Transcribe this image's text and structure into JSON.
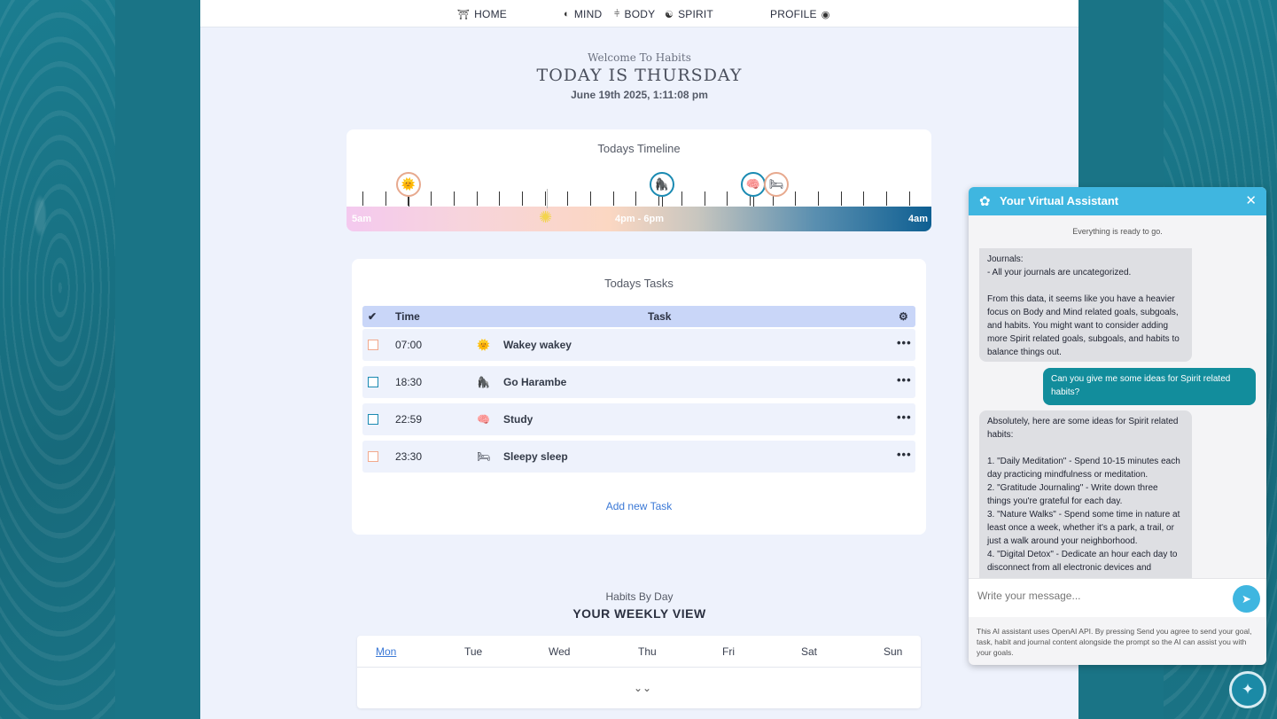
{
  "nav": {
    "home": "HOME",
    "mind": "MIND",
    "body": "BODY",
    "spirit": "SPIRIT",
    "profile": "PROFILE"
  },
  "welcome": {
    "subtitle": "Welcome To Habits",
    "title": "TODAY IS THURSDAY",
    "datetime": "June 19th 2025, 1:11:08 pm"
  },
  "timeline": {
    "title": "Todays Timeline",
    "start_label": "5am",
    "mid_label": "4pm - 6pm",
    "end_label": "4am"
  },
  "tasks": {
    "title": "Todays Tasks",
    "headers": {
      "time": "Time",
      "task": "Task"
    },
    "rows": [
      {
        "time": "07:00",
        "name": "Wakey wakey",
        "icon": "sun-icon",
        "done": false
      },
      {
        "time": "18:30",
        "name": "Go Harambe",
        "icon": "gorilla-icon",
        "done": false
      },
      {
        "time": "22:59",
        "name": "Study",
        "icon": "brain-icon",
        "done": false
      },
      {
        "time": "23:30",
        "name": "Sleepy sleep",
        "icon": "bed-icon",
        "done": false
      }
    ],
    "add_label": "Add new Task"
  },
  "habits": {
    "subtitle": "Habits By Day",
    "title": "YOUR WEEKLY VIEW",
    "days": [
      "Mon",
      "Tue",
      "Wed",
      "Thu",
      "Fri",
      "Sat",
      "Sun"
    ],
    "active_day": "Mon"
  },
  "assistant": {
    "title": "Your Virtual Assistant",
    "status": "Everything is ready to go.",
    "messages": [
      {
        "role": "ai",
        "text": "Journals:\n- All your journals are uncategorized.\n\nFrom this data, it seems like you have a heavier focus on Body and Mind related goals, subgoals, and habits. You might want to consider adding more Spirit related goals, subgoals, and habits to balance things out."
      },
      {
        "role": "user",
        "text": "Can you give me some ideas for Spirit related habits?"
      },
      {
        "role": "ai",
        "text": "Absolutely, here are some ideas for Spirit related habits:\n\n1. \"Daily Meditation\" - Spend 10-15 minutes each day practicing mindfulness or meditation.\n2. \"Gratitude Journaling\" - Write down three things you're grateful for each day.\n3. \"Nature Walks\" - Spend some time in nature at least once a week, whether it's a park, a trail, or just a walk around your neighborhood.\n4. \"Digital Detox\" - Dedicate an hour each day to disconnect from all electronic devices and"
      }
    ],
    "input_placeholder": "Write your message...",
    "disclaimer": "This AI assistant uses OpenAI API. By pressing Send you agree to send your goal, task, habit and journal content alongside the prompt so the AI can assist you with your goals."
  },
  "colors": {
    "assistant_accent": "#3fb6e0",
    "user_bubble": "#128d9c",
    "link": "#3a78d6",
    "background": "#1a7a8c"
  }
}
